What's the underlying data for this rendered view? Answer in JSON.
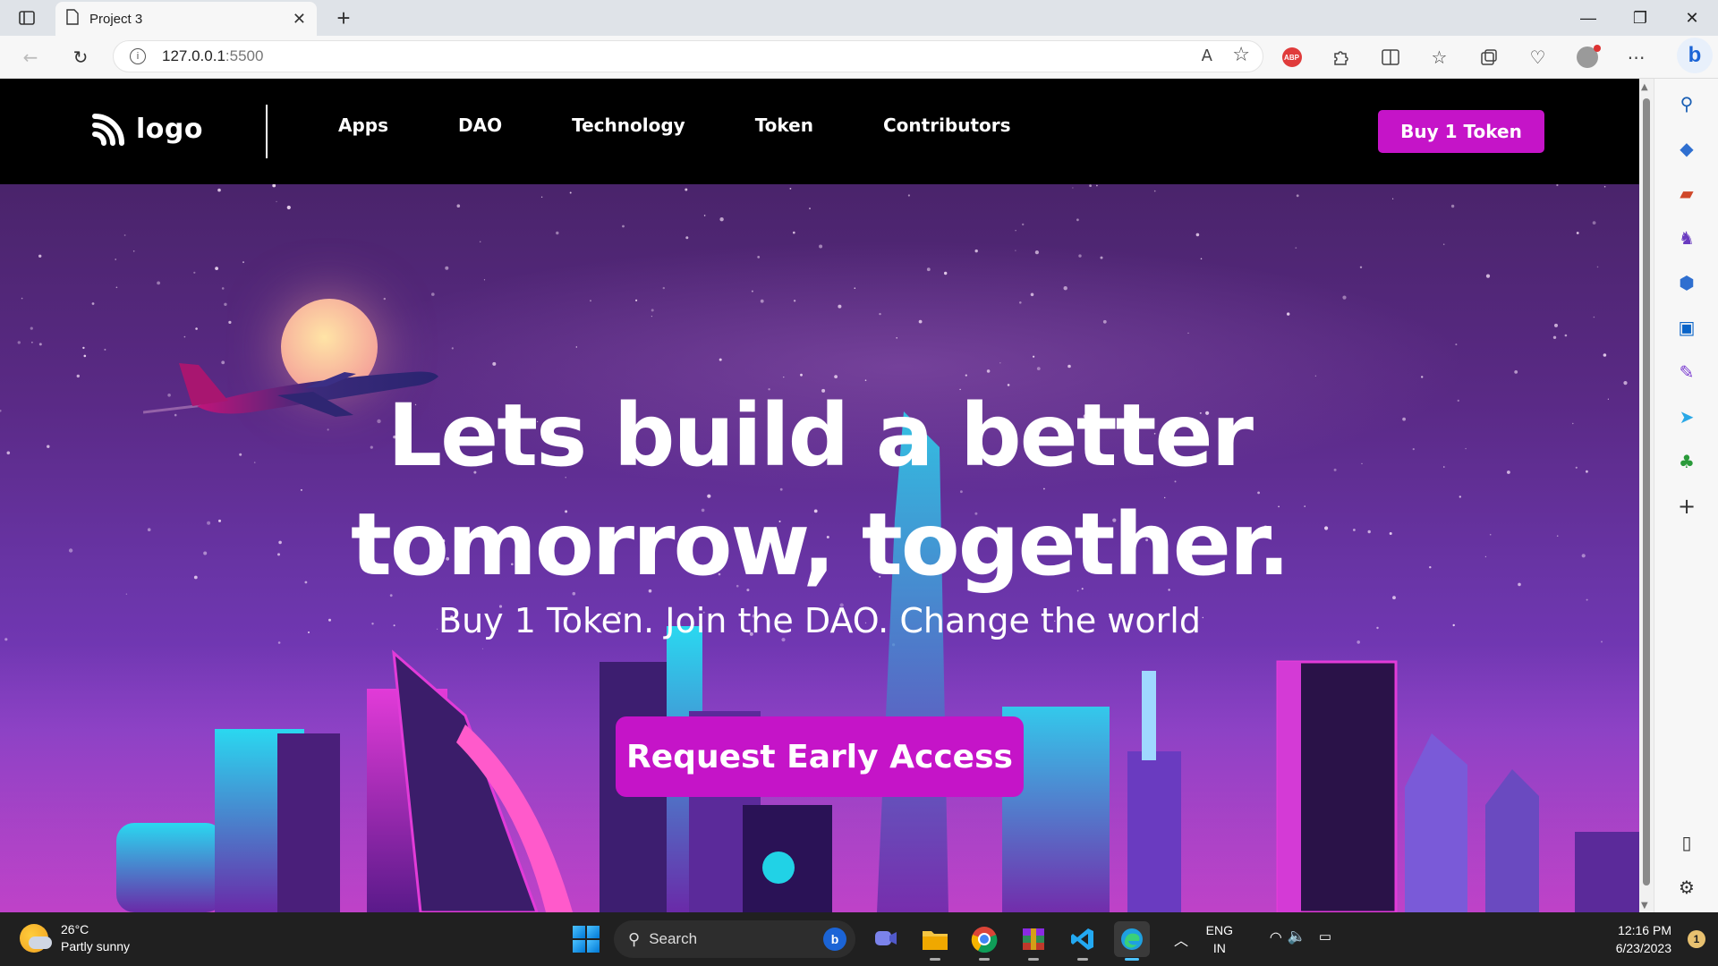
{
  "browser": {
    "tab_title": "Project 3",
    "tab_close": "✕",
    "new_tab": "+",
    "window_controls": [
      "—",
      "❐",
      "✕"
    ],
    "url_host": "127.0.0.1",
    "url_port": ":5500",
    "read_aloud": "A",
    "favorite_star": "☆",
    "bing_label": "b"
  },
  "site": {
    "logo_text": "logo",
    "nav": [
      "Apps",
      "DAO",
      "Technology",
      "Token",
      "Contributors"
    ],
    "buy_button": "Buy 1 Token",
    "hero_title_line1": "Lets build a better",
    "hero_title_line2": "tomorrow, together.",
    "hero_subtitle": "Buy 1 Token. Join the DAO. Change the world",
    "cta_button": "Request Early Access",
    "brand_color": "#c514c8"
  },
  "taskbar": {
    "temperature": "26°C",
    "weather": "Partly sunny",
    "search_placeholder": "Search",
    "lang": "ENG",
    "region": "IN",
    "time": "12:16 PM",
    "date": "6/23/2023",
    "notification_count": "1"
  }
}
